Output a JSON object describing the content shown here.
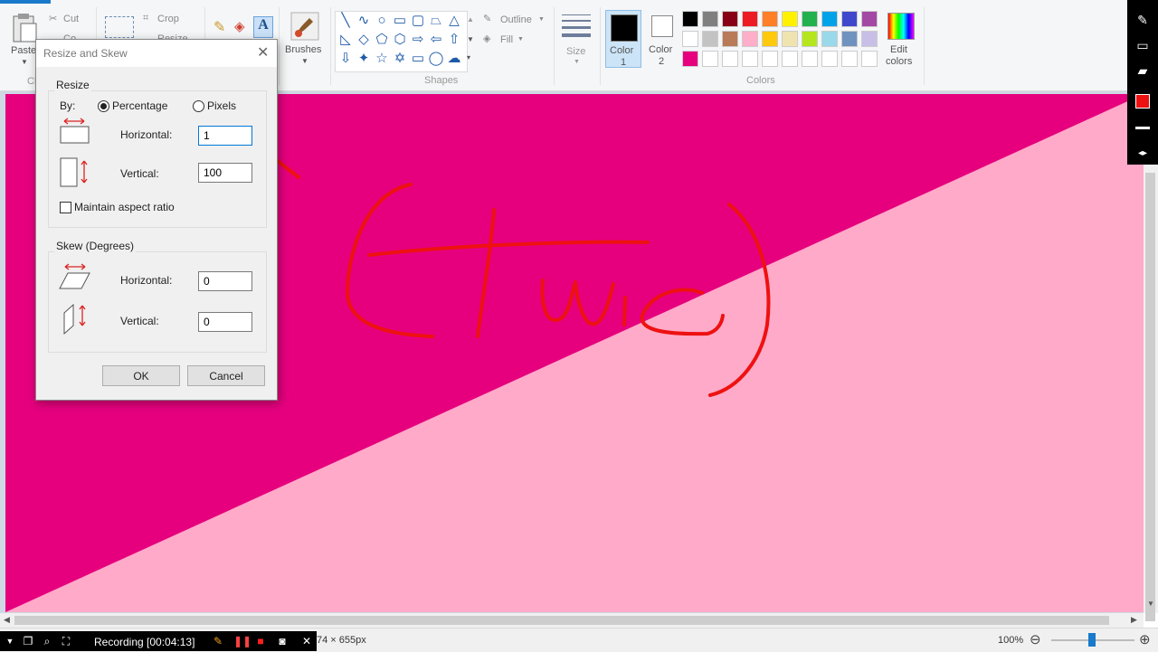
{
  "ribbon": {
    "clipboard": {
      "paste": "Paste",
      "cut": "Cut",
      "copy": "Co",
      "group": "Cli"
    },
    "image": {
      "crop": "Crop",
      "resize": "Resize"
    },
    "brushes": "Brushes",
    "shapes_group": "Shapes",
    "outline": "Outline",
    "fill": "Fill",
    "size": "Size",
    "color1": {
      "line1": "Color",
      "line2": "1"
    },
    "color2": {
      "line1": "Color",
      "line2": "2"
    },
    "colors_group": "Colors",
    "edit_colors": {
      "line1": "Edit",
      "line2": "colors"
    },
    "palette": [
      "#000000",
      "#7f7f7f",
      "#880015",
      "#ed1c24",
      "#ff7f27",
      "#fff200",
      "#22b14c",
      "#00a2e8",
      "#3f48cc",
      "#a349a4",
      "#ffffff",
      "#c3c3c3",
      "#b97a57",
      "#ffaec9",
      "#ffc90e",
      "#efe4b0",
      "#b5e61d",
      "#99d9ea",
      "#7092be",
      "#c8bfe7",
      "#e6007e"
    ]
  },
  "canvas": {
    "color_top": "#e6007e",
    "color_bottom": "#ffaac8",
    "drawing_color": "#ee1111"
  },
  "dialog": {
    "title": "Resize and Skew",
    "resize_group": "Resize",
    "by_label": "By:",
    "percentage": "Percentage",
    "pixels": "Pixels",
    "horizontal_label": "Horizontal:",
    "horizontal_value": "1",
    "vertical_label": "Vertical:",
    "vertical_value": "100",
    "maintain_aspect": "Maintain aspect ratio",
    "skew_group": "Skew (Degrees)",
    "skew_horizontal_label": "Horizontal:",
    "skew_horizontal_value": "0",
    "skew_vertical_label": "Vertical:",
    "skew_vertical_value": "0",
    "ok": "OK",
    "cancel": "Cancel"
  },
  "status": {
    "dimensions": "74 × 655px",
    "zoom": "100%"
  },
  "recorder": {
    "label": "Recording [00:04:13]"
  }
}
